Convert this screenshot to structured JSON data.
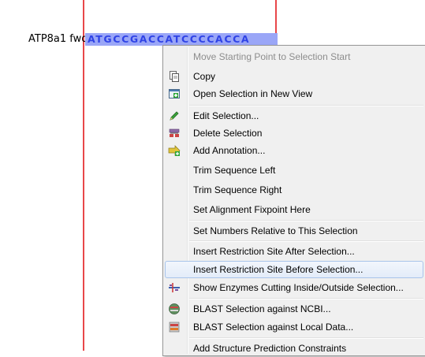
{
  "sequence": {
    "label": "ATP8a1 fwd",
    "residues": "ATGCCGACCATCCCCACCA"
  },
  "colors": {
    "marker": "#e8474a",
    "selection_bg": "#9aa6f7",
    "sequence_text": "#2f43e6",
    "menu_bg": "#f0f0f0"
  },
  "context_menu": {
    "items": [
      {
        "label": "Move Starting Point to Selection Start",
        "icon": "",
        "disabled": true
      },
      {
        "label": "Copy",
        "icon": "copy-icon"
      },
      {
        "label": "Open Selection in New View",
        "icon": "open-view-icon"
      },
      {
        "label": "Edit Selection...",
        "icon": "pencil-icon"
      },
      {
        "label": "Delete Selection",
        "icon": "delete-selection-icon"
      },
      {
        "label": "Add Annotation...",
        "icon": "add-annotation-icon"
      },
      {
        "label": "Trim Sequence Left",
        "icon": ""
      },
      {
        "label": "Trim Sequence Right",
        "icon": ""
      },
      {
        "label": "Set Alignment Fixpoint Here",
        "icon": ""
      },
      {
        "label": "Set Numbers Relative to This Selection",
        "icon": ""
      },
      {
        "label": "Insert Restriction Site After Selection...",
        "icon": ""
      },
      {
        "label": "Insert Restriction Site Before Selection...",
        "icon": "",
        "highlighted": true
      },
      {
        "label": "Show Enzymes Cutting Inside/Outside Selection...",
        "icon": "enzymes-icon"
      },
      {
        "label": "BLAST Selection against NCBI...",
        "icon": "blast-ncbi-icon"
      },
      {
        "label": "BLAST Selection against Local Data...",
        "icon": "blast-local-icon"
      },
      {
        "label": "Add Structure Prediction Constraints",
        "icon": ""
      }
    ]
  }
}
